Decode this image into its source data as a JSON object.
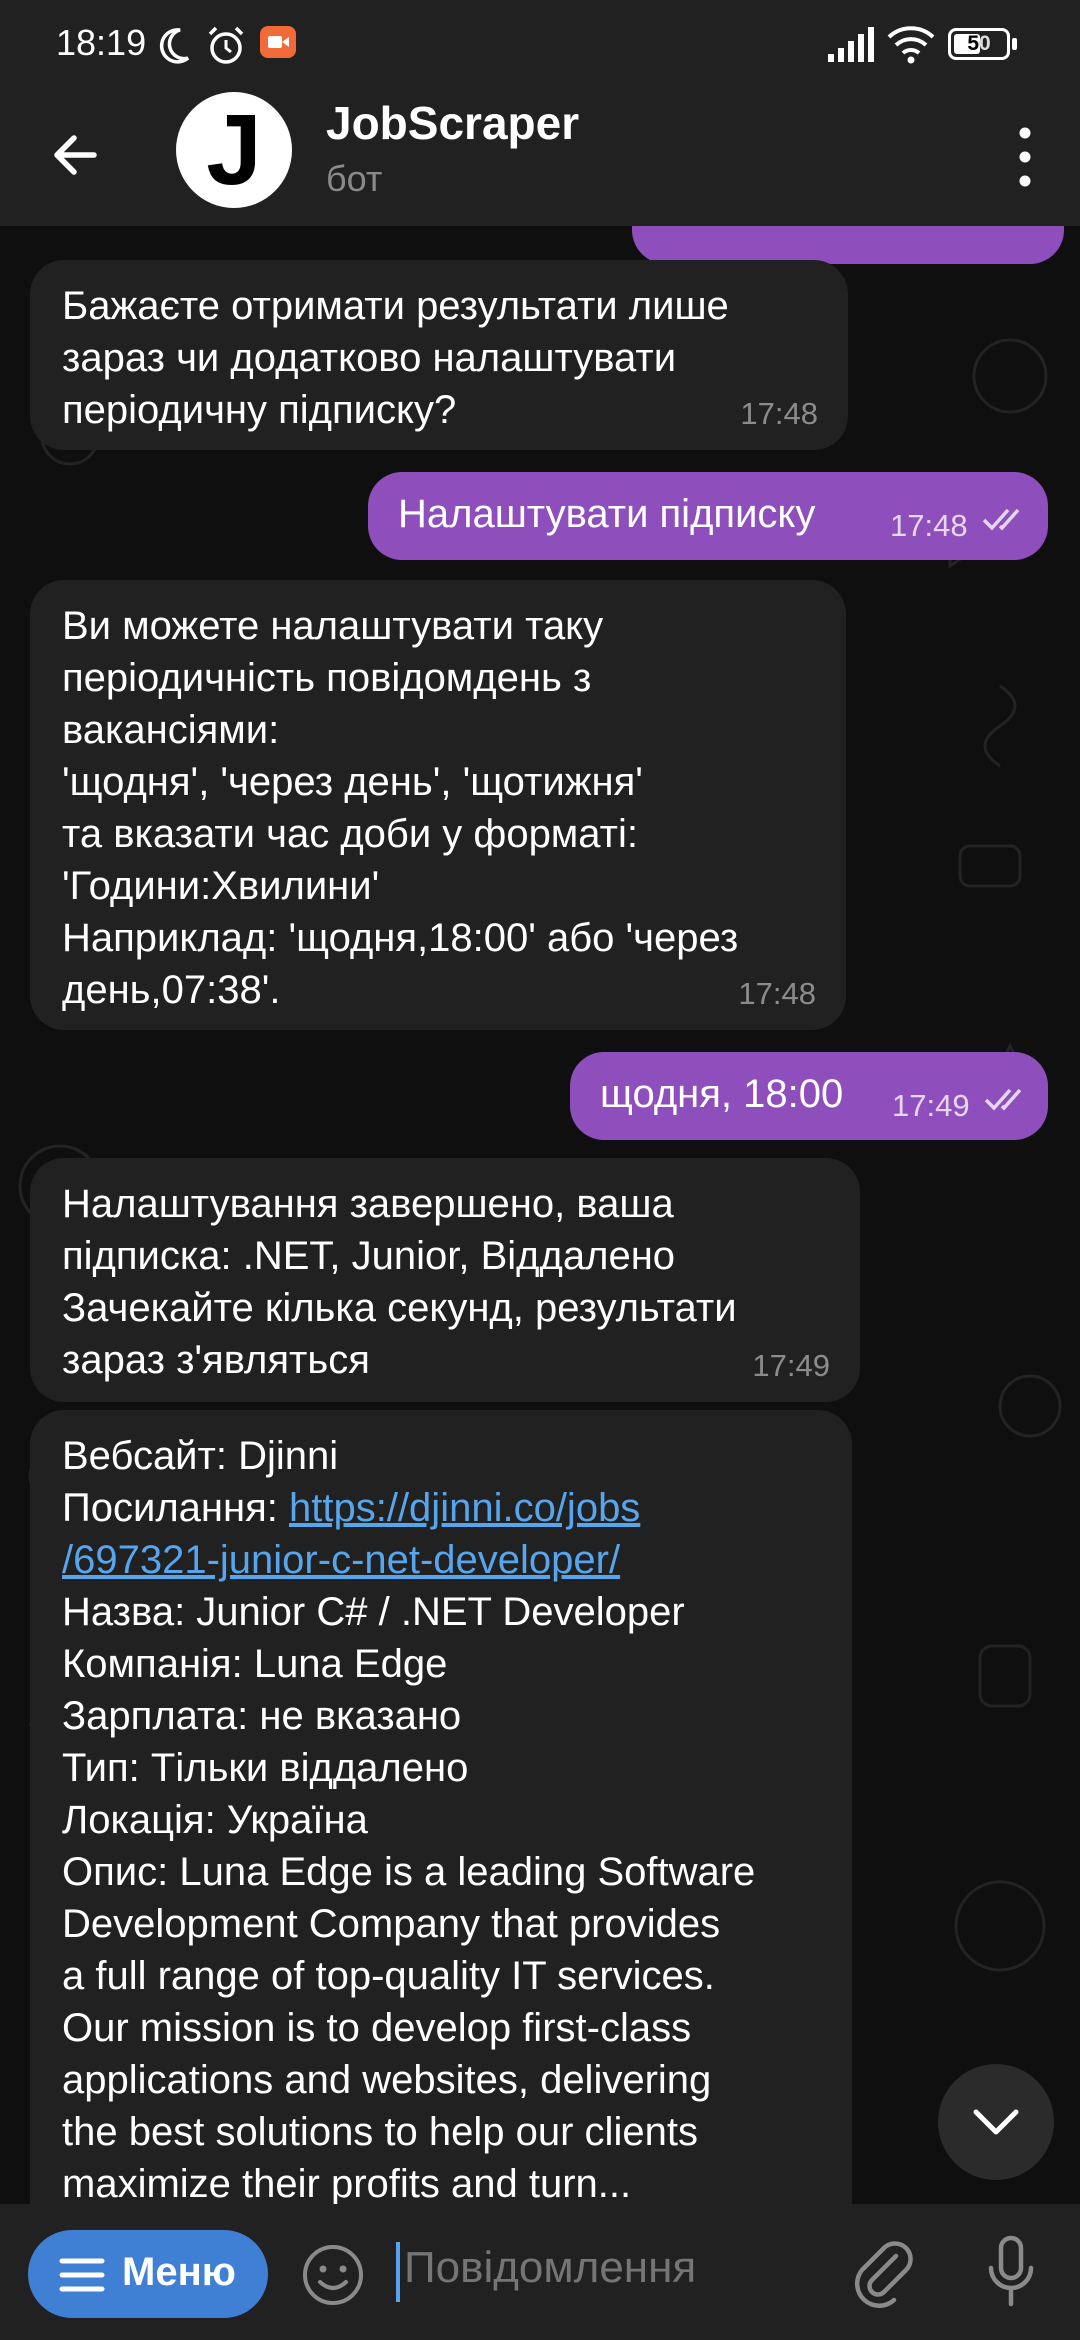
{
  "status_bar": {
    "time": "18:19",
    "battery": "50",
    "icons": [
      "moon-icon",
      "alarm-icon",
      "recording-icon",
      "signal-icon",
      "wifi-icon",
      "battery-icon"
    ]
  },
  "header": {
    "avatar_letter": "J",
    "title": "JobScraper",
    "subtitle": "бот"
  },
  "messages": [
    {
      "side": "in",
      "text": "Бажаєте отримати результати лише\nзараз чи додатково налаштувати\nперіодичну підписку?",
      "time": "17:48"
    },
    {
      "side": "out",
      "text": "Налаштувати підписку",
      "time": "17:48"
    },
    {
      "side": "in",
      "text": "Ви можете налаштувати таку\nперіодичність повідомдень з\nвакансіями:\n'щодня', 'через день', 'щотижня'\nта вказати час доби у форматі:\n'Години:Хвилини'\nНаприклад: 'щодня,18:00' або 'через\nдень,07:38'.",
      "time": "17:48"
    },
    {
      "side": "out",
      "text": "щодня, 18:00",
      "time": "17:49"
    },
    {
      "side": "in",
      "text": "Налаштування завершено, ваша\nпідписка: .NET, Junior, Віддалено\nЗачекайте кілька секунд, результати\nзараз з'являться",
      "time": "17:49"
    }
  ],
  "vacancy": {
    "site": "Вебсайт: Djinni",
    "link_label": "Посилання: ",
    "link_line1": "https://djinni.co/jobs",
    "link_line2": "/697321-junior-c-net-developer/",
    "name": "Назва: Junior C# / .NET Developer",
    "company": "Компанія: Luna Edge",
    "salary": "Зарплата: не вказано",
    "type": "Тип: Тільки віддалено",
    "location": "Локація: Україна",
    "description": "Опис: Luna Edge is a leading Software\nDevelopment Company that provides\na full range of top-quality IT services.\nOur mission is to develop first-class\napplications and websites, delivering\nthe best solutions to help our clients\nmaximize their profits and turn..."
  },
  "composer": {
    "menu_label": "Меню",
    "placeholder": "Повідомлення"
  },
  "colors": {
    "header_bg": "#212121",
    "incoming_bubble": "#212121",
    "outgoing_bubble": "#8e4fbd",
    "link": "#56a5ed",
    "menu_button": "#3f7fd4"
  }
}
